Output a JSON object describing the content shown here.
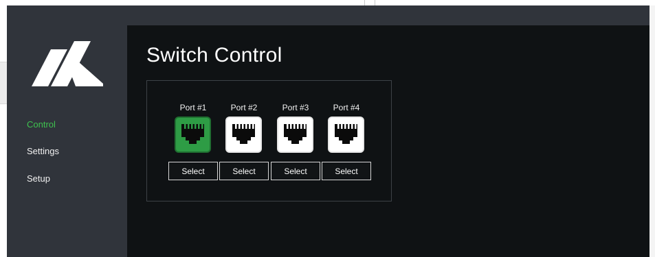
{
  "app": {
    "title": "Switch Control",
    "logo": "brand-logo-m"
  },
  "sidebar": {
    "items": [
      {
        "label": "Control",
        "active": true
      },
      {
        "label": "Settings",
        "active": false
      },
      {
        "label": "Setup",
        "active": false
      }
    ]
  },
  "ports": [
    {
      "label": "Port #1",
      "button": "Select",
      "selected": true
    },
    {
      "label": "Port #2",
      "button": "Select",
      "selected": false
    },
    {
      "label": "Port #3",
      "button": "Select",
      "selected": false
    },
    {
      "label": "Port #4",
      "button": "Select",
      "selected": false
    }
  ],
  "colors": {
    "sidebar_bg": "#30343b",
    "main_bg": "#0f1214",
    "accent_active": "#3ec24f",
    "port_selected": "#2e9c45",
    "port_idle": "#ffffff"
  },
  "icons": [
    "ethernet-port-icon"
  ]
}
